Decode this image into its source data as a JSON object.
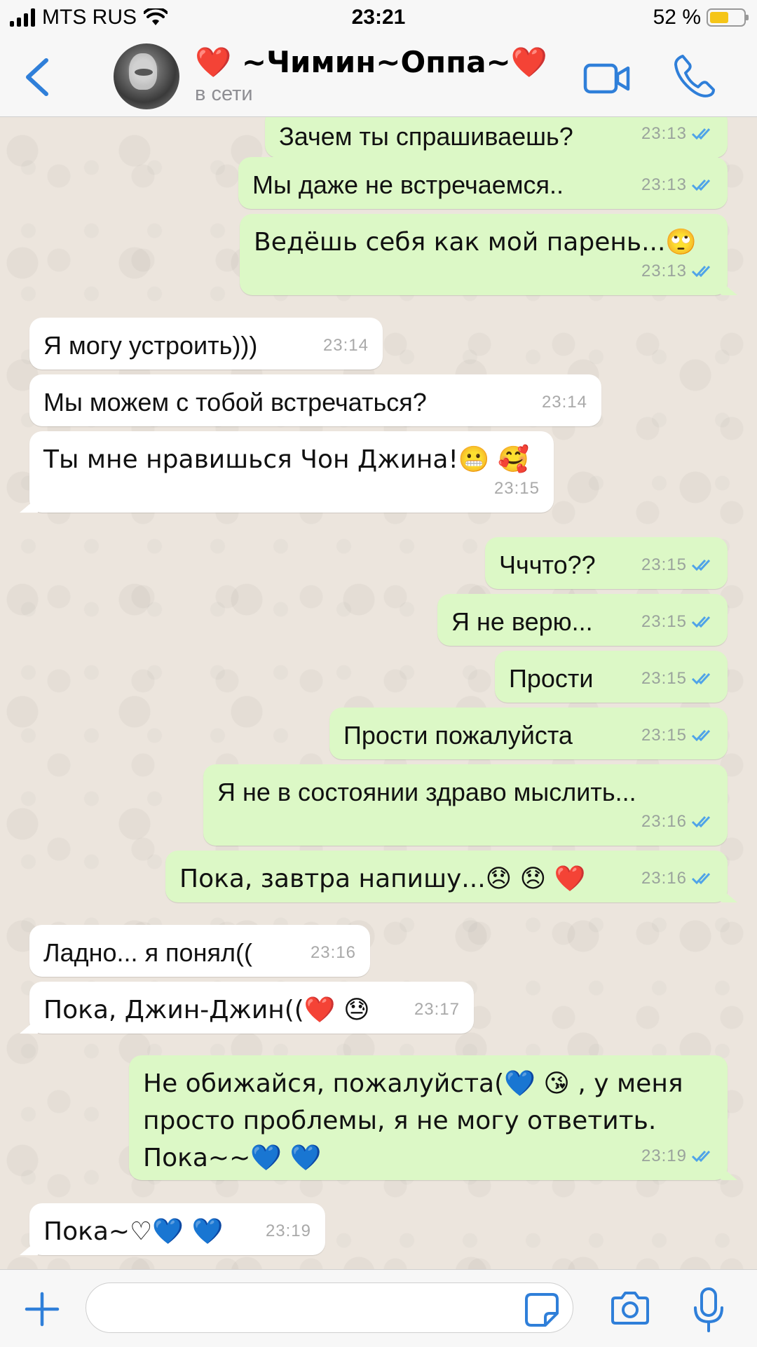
{
  "status_bar": {
    "carrier": "MTS RUS",
    "time": "23:21",
    "battery": "52 %"
  },
  "header": {
    "back_icon": "chevron-left-icon",
    "contact_name": "❤️ ~Чимин~Оппа~❤️",
    "contact_status": "в сети",
    "accent_color": "#2f7fd9"
  },
  "messages": [
    {
      "dir": "out",
      "text": "Зачем ты спрашиваешь?",
      "time": "23:13"
    },
    {
      "dir": "out",
      "text": "Мы даже не встречаемся..",
      "time": "23:13"
    },
    {
      "dir": "out",
      "text": "Ведёшь себя как мой парень...🙄",
      "time": "23:13"
    },
    {
      "dir": "in",
      "text": "Я могу устроить)))",
      "time": "23:14"
    },
    {
      "dir": "in",
      "text": "Мы можем с тобой встречаться?",
      "time": "23:14"
    },
    {
      "dir": "in",
      "text": "Ты мне нравишься Чон Джина!😬 🥰",
      "time": "23:15"
    },
    {
      "dir": "out",
      "text": "Чччто??",
      "time": "23:15"
    },
    {
      "dir": "out",
      "text": "Я не верю...",
      "time": "23:15"
    },
    {
      "dir": "out",
      "text": "Прости",
      "time": "23:15"
    },
    {
      "dir": "out",
      "text": "Прости пожалуйста",
      "time": "23:15"
    },
    {
      "dir": "out",
      "text": "Я не в состоянии здраво мыслить...",
      "time": "23:16"
    },
    {
      "dir": "out",
      "text": "Пока, завтра напишу...😞 😞 ❤️",
      "time": "23:16"
    },
    {
      "dir": "in",
      "text": "Ладно... я понял((",
      "time": "23:16"
    },
    {
      "dir": "in",
      "text": "Пока, Джин-Джин((❤️ 😓",
      "time": "23:17"
    },
    {
      "dir": "out",
      "text": "Не обижайся, пожалуйста(💙 😘 , у меня\nпросто проблемы, я не могу ответить.\nПока~~💙 💙",
      "time": "23:19"
    },
    {
      "dir": "in",
      "text": "Пока~♡💙 💙",
      "time": "23:19"
    }
  ],
  "input": {
    "value": "",
    "placeholder": ""
  },
  "colors": {
    "outgoing_bubble": "#dcf8c6",
    "incoming_bubble": "#ffffff",
    "chat_background": "#ece5dd",
    "read_ticks": "#4fa3e8"
  }
}
